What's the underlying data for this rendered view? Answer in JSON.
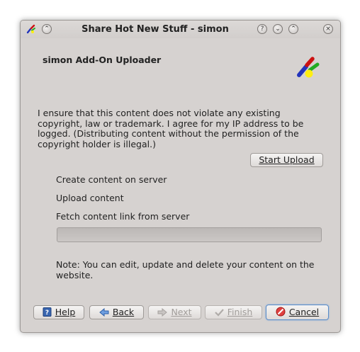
{
  "window": {
    "title": "Share Hot New Stuff - simon",
    "controls": [
      "help-icon",
      "minimize-icon",
      "maximize-icon",
      "close-icon"
    ]
  },
  "page": {
    "heading": "simon Add-On Uploader",
    "disclaimer": "I ensure that this content does not violate any existing copyright, law or trademark. I agree for my IP address to be logged. (Distributing content without the permission of the copyright holder is illegal.)",
    "start_upload_label": "Start Upload",
    "steps": [
      "Create content on server",
      "Upload content",
      "Fetch content link from server"
    ],
    "progress": 0,
    "note": "Note: You can edit, update and delete your content on the website."
  },
  "footer": {
    "help_label": "Help",
    "back_label": "Back",
    "next_label": "Next",
    "finish_label": "Finish",
    "cancel_label": "Cancel"
  },
  "colors": {
    "window_bg": "#d6d2d0",
    "focus_border": "#5a8cc8",
    "logo_red": "#cc1111",
    "logo_green": "#22aa22",
    "logo_blue": "#2233bb",
    "logo_yellow": "#ffee11"
  }
}
